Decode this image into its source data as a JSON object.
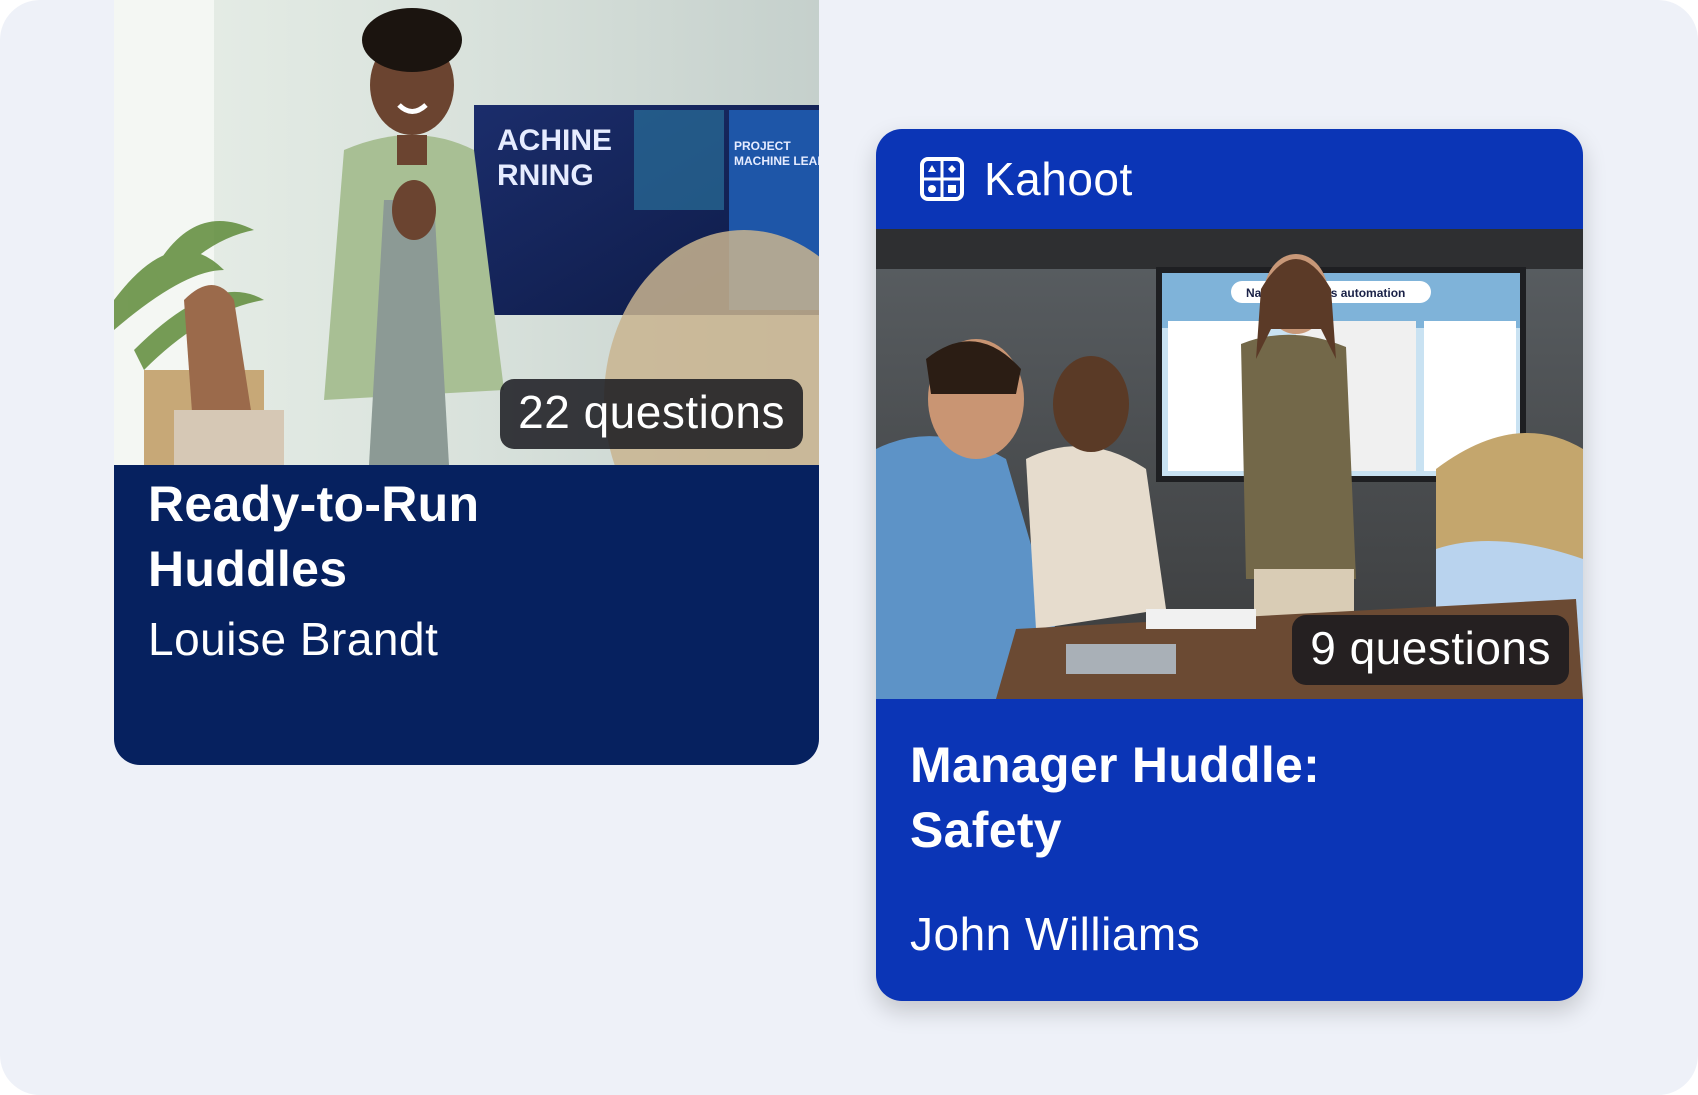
{
  "cards": [
    {
      "badge": "22 questions",
      "title_line1": "Ready-to-Run",
      "title_line2": "Huddles",
      "author": "Louise Brandt",
      "image_alt": "presenter-applauding-photo"
    },
    {
      "brand": "Kahoot",
      "brand_icon": "grid-shapes-icon",
      "badge": "9 questions",
      "title_line1": "Manager Huddle:",
      "title_line2": "Safety",
      "author": "John Williams",
      "image_alt": "team-meeting-photo"
    }
  ],
  "colors": {
    "background": "#eef1f8",
    "card_left": "#06215f",
    "card_right": "#0b35b6",
    "badge": "#19191e"
  }
}
